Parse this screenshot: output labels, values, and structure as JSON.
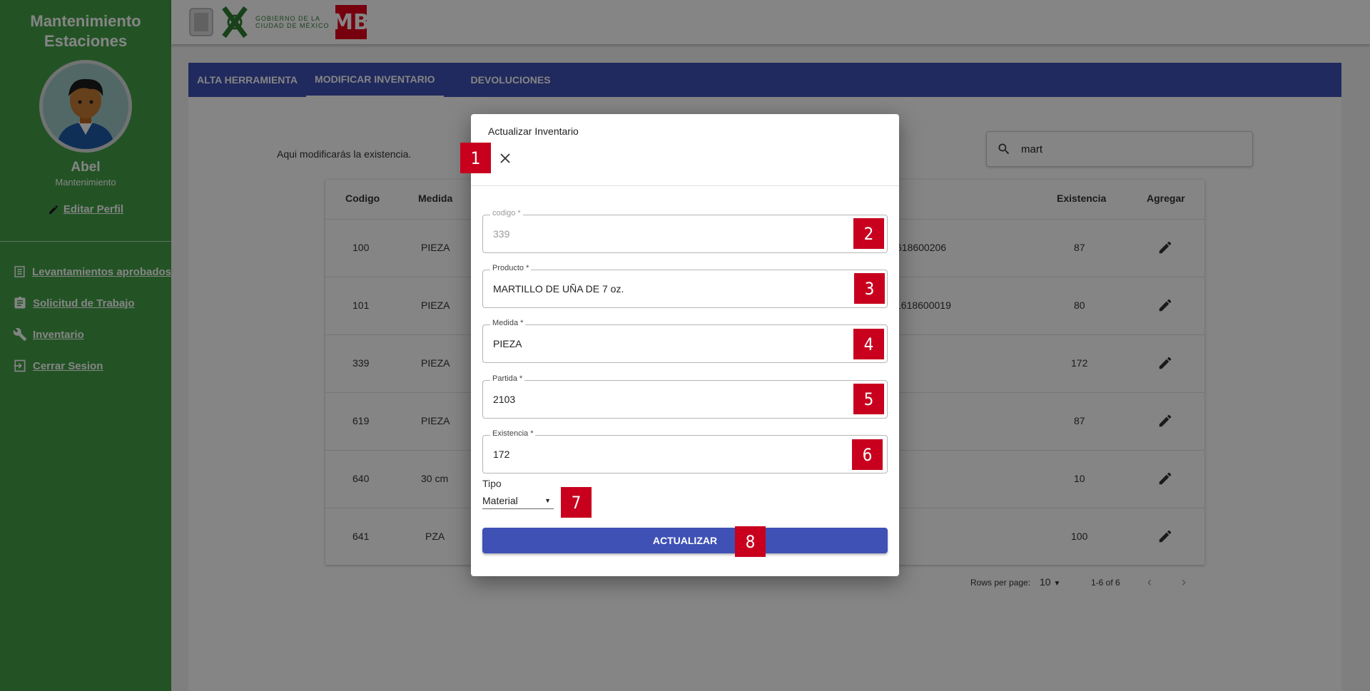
{
  "sidebar": {
    "title_line1": "Mantenimiento",
    "title_line2": "Estaciones",
    "user_name": "Abel",
    "user_role": "Mantenimiento",
    "edit_profile": "Editar Perfil",
    "items": [
      {
        "label": "Levantamientos aprobados",
        "icon": "list-icon"
      },
      {
        "label": "Solicitud de Trabajo",
        "icon": "clipboard-icon"
      },
      {
        "label": "Inventario",
        "icon": "wrench-icon"
      },
      {
        "label": "Cerrar Sesion",
        "icon": "logout-icon"
      }
    ]
  },
  "header": {
    "logo_text_line1": "GOBIERNO DE LA",
    "logo_text_line2": "CIUDAD DE MÉXICO",
    "metro_logo": "MB"
  },
  "tabs": [
    {
      "label": "ALTA HERRAMIENTA"
    },
    {
      "label": "MODIFICAR INVENTARIO"
    },
    {
      "label": "DEVOLUCIONES"
    }
  ],
  "main": {
    "hint": "Aqui modificarás la existencia.",
    "search_value": "mart",
    "columns": {
      "codigo": "Codigo",
      "medida": "Medida",
      "existencia": "Existencia",
      "agregar": "Agregar"
    },
    "rows": [
      {
        "codigo": "100",
        "medida": "PIEZA",
        "extra": "618600206",
        "existencia": "87"
      },
      {
        "codigo": "101",
        "medida": "PIEZA",
        "extra": "1618600019",
        "existencia": "80"
      },
      {
        "codigo": "339",
        "medida": "PIEZA",
        "extra": "",
        "existencia": "172"
      },
      {
        "codigo": "619",
        "medida": "PIEZA",
        "extra": "",
        "existencia": "87"
      },
      {
        "codigo": "640",
        "medida": "30 cm",
        "extra": "",
        "existencia": "10"
      },
      {
        "codigo": "641",
        "medida": "PZA",
        "extra": "",
        "existencia": "100"
      }
    ],
    "pager": {
      "rows_per_page_label": "Rows per page:",
      "rows_per_page": "10",
      "range": "1-6 of 6"
    }
  },
  "modal": {
    "title": "Actualizar Inventario",
    "fields": [
      {
        "label": "codigo *",
        "value": "339",
        "disabled": true
      },
      {
        "label": "Producto *",
        "value": "MARTILLO DE UÑA DE 7 oz."
      },
      {
        "label": "Medida *",
        "value": "PIEZA"
      },
      {
        "label": "Partida  *",
        "value": "2103"
      },
      {
        "label": "Existencia *",
        "value": "172"
      }
    ],
    "tipo_label": "Tipo",
    "tipo_value": "Material",
    "submit_label": "ACTUALIZAR"
  },
  "markers": [
    "1",
    "2",
    "3",
    "4",
    "5",
    "6",
    "7",
    "8"
  ],
  "colors": {
    "sidebar": "#43a047",
    "primary": "#3f51b5",
    "marker": "#c8001e"
  }
}
